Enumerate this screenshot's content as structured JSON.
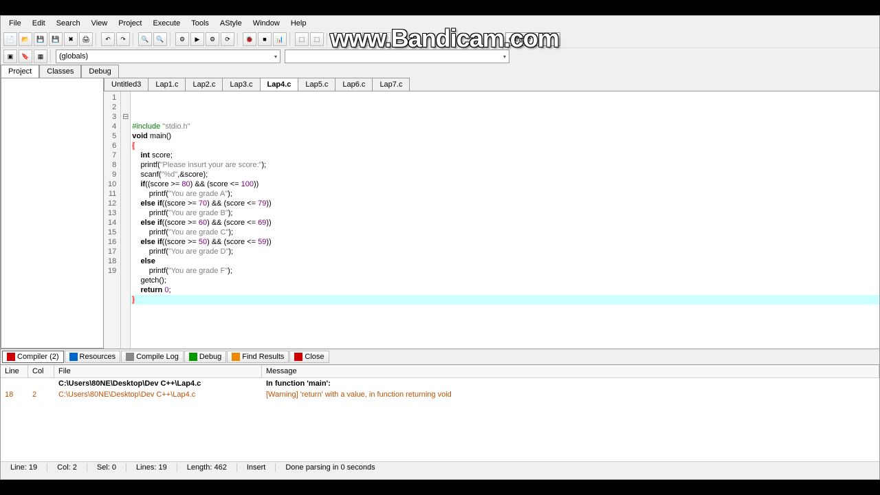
{
  "watermark": "www.Bandicam.com",
  "menu": [
    "File",
    "Edit",
    "Search",
    "View",
    "Project",
    "Execute",
    "Tools",
    "AStyle",
    "Window",
    "Help"
  ],
  "combo_release": "elease",
  "combo_globals": "(globals)",
  "leftTabs": [
    "Project",
    "Classes",
    "Debug"
  ],
  "fileTabs": [
    "Untitled3",
    "Lap1.c",
    "Lap2.c",
    "Lap3.c",
    "Lap4.c",
    "Lap5.c",
    "Lap6.c",
    "Lap7.c"
  ],
  "activeFileTab": 4,
  "code": {
    "lines": [
      {
        "n": 1,
        "indent": 0,
        "tokens": [
          {
            "t": "#include ",
            "c": "pre"
          },
          {
            "t": "\"stdio.h\"",
            "c": "str"
          }
        ]
      },
      {
        "n": 2,
        "indent": 0,
        "tokens": [
          {
            "t": "void",
            "c": "kw"
          },
          {
            "t": " main()",
            "c": ""
          }
        ]
      },
      {
        "n": 3,
        "indent": 0,
        "fold": "⊟",
        "tokens": [
          {
            "t": "{",
            "c": "brace"
          }
        ]
      },
      {
        "n": 4,
        "indent": 1,
        "tokens": [
          {
            "t": "int",
            "c": "kw"
          },
          {
            "t": " score;",
            "c": ""
          }
        ]
      },
      {
        "n": 5,
        "indent": 1,
        "tokens": [
          {
            "t": "printf(",
            "c": ""
          },
          {
            "t": "\"Please insurt your are score:\"",
            "c": "str"
          },
          {
            "t": ");",
            "c": ""
          }
        ]
      },
      {
        "n": 6,
        "indent": 1,
        "tokens": [
          {
            "t": "scanf(",
            "c": ""
          },
          {
            "t": "\"%d\"",
            "c": "str"
          },
          {
            "t": ",&score);",
            "c": ""
          }
        ]
      },
      {
        "n": 7,
        "indent": 1,
        "tokens": [
          {
            "t": "if",
            "c": "kw"
          },
          {
            "t": "((score >= ",
            "c": ""
          },
          {
            "t": "80",
            "c": "num"
          },
          {
            "t": ") && (score <= ",
            "c": ""
          },
          {
            "t": "100",
            "c": "num"
          },
          {
            "t": "))",
            "c": ""
          }
        ]
      },
      {
        "n": 8,
        "indent": 2,
        "tokens": [
          {
            "t": "printf(",
            "c": ""
          },
          {
            "t": "\"You are grade A\"",
            "c": "str"
          },
          {
            "t": ");",
            "c": ""
          }
        ]
      },
      {
        "n": 9,
        "indent": 1,
        "tokens": [
          {
            "t": "else if",
            "c": "kw"
          },
          {
            "t": "((score >= ",
            "c": ""
          },
          {
            "t": "70",
            "c": "num"
          },
          {
            "t": ") && (score <= ",
            "c": ""
          },
          {
            "t": "79",
            "c": "num"
          },
          {
            "t": "))",
            "c": ""
          }
        ]
      },
      {
        "n": 10,
        "indent": 2,
        "tokens": [
          {
            "t": "printf(",
            "c": ""
          },
          {
            "t": "\"You are grade B\"",
            "c": "str"
          },
          {
            "t": ");",
            "c": ""
          }
        ]
      },
      {
        "n": 11,
        "indent": 1,
        "tokens": [
          {
            "t": "else if",
            "c": "kw"
          },
          {
            "t": "((score >= ",
            "c": ""
          },
          {
            "t": "60",
            "c": "num"
          },
          {
            "t": ") && (score <= ",
            "c": ""
          },
          {
            "t": "69",
            "c": "num"
          },
          {
            "t": "))",
            "c": ""
          }
        ]
      },
      {
        "n": 12,
        "indent": 2,
        "tokens": [
          {
            "t": "printf(",
            "c": ""
          },
          {
            "t": "\"You are grade C\"",
            "c": "str"
          },
          {
            "t": ");",
            "c": ""
          }
        ]
      },
      {
        "n": 13,
        "indent": 1,
        "tokens": [
          {
            "t": "else if",
            "c": "kw"
          },
          {
            "t": "((score >= ",
            "c": ""
          },
          {
            "t": "50",
            "c": "num"
          },
          {
            "t": ") && (score <= ",
            "c": ""
          },
          {
            "t": "59",
            "c": "num"
          },
          {
            "t": "))",
            "c": ""
          }
        ]
      },
      {
        "n": 14,
        "indent": 2,
        "tokens": [
          {
            "t": "printf(",
            "c": ""
          },
          {
            "t": "\"You are grade D\"",
            "c": "str"
          },
          {
            "t": ");",
            "c": ""
          }
        ]
      },
      {
        "n": 15,
        "indent": 1,
        "tokens": [
          {
            "t": "else",
            "c": "kw"
          }
        ]
      },
      {
        "n": 16,
        "indent": 2,
        "tokens": [
          {
            "t": "printf(",
            "c": ""
          },
          {
            "t": "\"You are grade F\"",
            "c": "str"
          },
          {
            "t": ");",
            "c": ""
          }
        ]
      },
      {
        "n": 17,
        "indent": 1,
        "tokens": [
          {
            "t": "getch();",
            "c": ""
          }
        ]
      },
      {
        "n": 18,
        "indent": 1,
        "tokens": [
          {
            "t": "return ",
            "c": "kw"
          },
          {
            "t": "0",
            "c": "num"
          },
          {
            "t": ";",
            "c": ""
          }
        ]
      },
      {
        "n": 19,
        "indent": 0,
        "hl": true,
        "tokens": [
          {
            "t": "}",
            "c": "brace"
          }
        ]
      }
    ]
  },
  "bottomTabs": [
    {
      "label": "Compiler (2)",
      "icon": "red",
      "active": true
    },
    {
      "label": "Resources",
      "icon": "blue"
    },
    {
      "label": "Compile Log",
      "icon": "gray"
    },
    {
      "label": "Debug",
      "icon": "grn"
    },
    {
      "label": "Find Results",
      "icon": "orn"
    },
    {
      "label": "Close",
      "icon": "red"
    }
  ],
  "msgHeaders": {
    "line": "Line",
    "col": "Col",
    "file": "File",
    "message": "Message"
  },
  "msgRows": [
    {
      "line": "",
      "col": "",
      "file": "C:\\Users\\80NE\\Desktop\\Dev C++\\Lap4.c",
      "msg": "In function 'main':",
      "bold": true
    },
    {
      "line": "18",
      "col": "2",
      "file": "C:\\Users\\80NE\\Desktop\\Dev C++\\Lap4.c",
      "msg": "[Warning] 'return' with a value, in function returning void",
      "warn": true
    }
  ],
  "status": {
    "line": "Line:   19",
    "col": "Col:   2",
    "sel": "Sel:   0",
    "lines": "Lines:   19",
    "length": "Length:   462",
    "insert": "Insert",
    "done": "Done parsing in 0 seconds"
  }
}
